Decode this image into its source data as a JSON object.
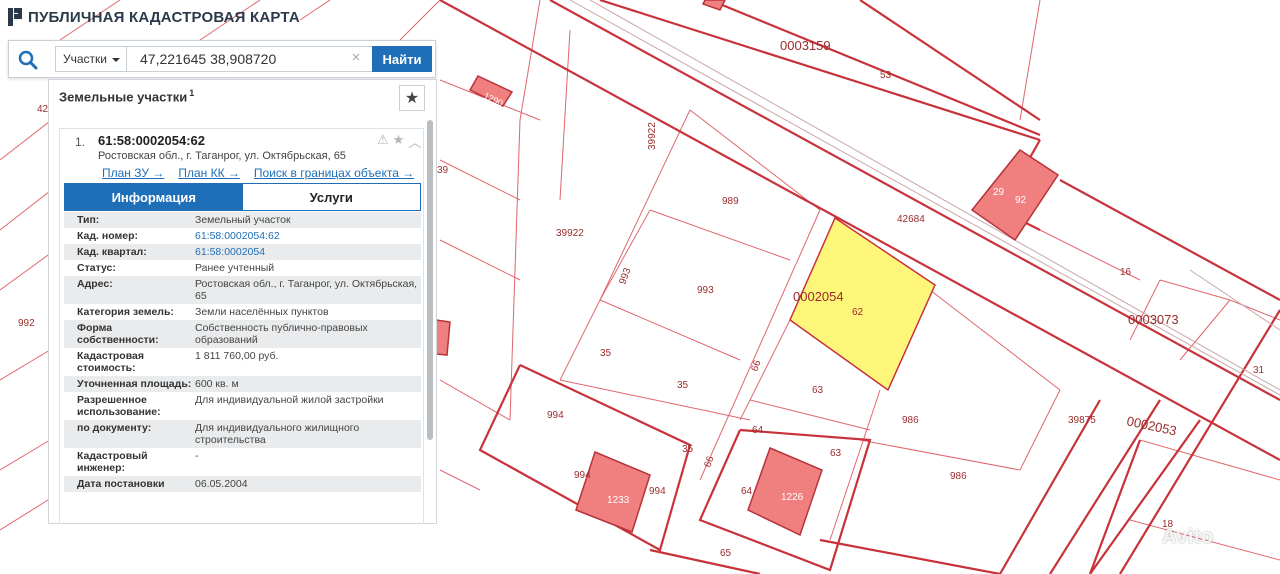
{
  "app": {
    "title": "ПУБЛИЧНАЯ КАДАСТРОВАЯ КАРТА",
    "logo": "pkk-logo-icon"
  },
  "search": {
    "type_label": "Участки",
    "query": "47,221645 38,908720",
    "clear": "×",
    "button": "Найти"
  },
  "panel": {
    "title": "Земельные участки",
    "count": "1",
    "item": {
      "number": "1.",
      "cad_number": "61:58:0002054:62",
      "address": "Ростовская обл., г. Таганрог, ул. Октябрьская, 65",
      "links": [
        "План ЗУ →",
        "План КК →",
        "Поиск в границах объекта →"
      ]
    },
    "tabs": [
      "Информация",
      "Услуги"
    ],
    "properties": [
      {
        "key": "Тип:",
        "value": "Земельный участок"
      },
      {
        "key": "Кад. номер:",
        "value": "61:58:0002054:62",
        "link": true
      },
      {
        "key": "Кад. квартал:",
        "value": "61:58:0002054",
        "link": true
      },
      {
        "key": "Статус:",
        "value": "Ранее учтенный"
      },
      {
        "key": "Адрес:",
        "value": "Ростовская обл., г. Таганрог, ул. Октябрьская, 65"
      },
      {
        "key": "Категория земель:",
        "value": "Земли населённых пунктов"
      },
      {
        "key": "Форма собственности:",
        "value": "Собственность публично-правовых образований"
      },
      {
        "key": "Кадастровая стоимость:",
        "value": "1 811 760,00 руб."
      },
      {
        "key": "Уточненная площадь:",
        "value": "600 кв. м"
      },
      {
        "key": "Разрешенное использование:",
        "value": "Для индивидуальной жилой застройки"
      },
      {
        "key": "по документу:",
        "value": "Для индивидуального жилищного строительства"
      },
      {
        "key": "Кадастровый инженер:",
        "value": "-"
      },
      {
        "key": "Дата постановки",
        "value": "06.05.2004"
      }
    ]
  },
  "map_labels": [
    {
      "id": "q3159",
      "text": "0003159"
    },
    {
      "id": "p53",
      "text": "53"
    },
    {
      "id": "p39922a",
      "text": "39922"
    },
    {
      "id": "p39922b",
      "text": "39922"
    },
    {
      "id": "p989",
      "text": "989"
    },
    {
      "id": "p42684",
      "text": "42684"
    },
    {
      "id": "p29",
      "text": "29"
    },
    {
      "id": "p92",
      "text": "92"
    },
    {
      "id": "p16",
      "text": "16"
    },
    {
      "id": "q3073",
      "text": "0003073"
    },
    {
      "id": "q2054",
      "text": "0002054"
    },
    {
      "id": "p62",
      "text": "62"
    },
    {
      "id": "p993a",
      "text": "993"
    },
    {
      "id": "p993b",
      "text": "993"
    },
    {
      "id": "p35a",
      "text": "35"
    },
    {
      "id": "p35b",
      "text": "35"
    },
    {
      "id": "p35c",
      "text": "35"
    },
    {
      "id": "p63a",
      "text": "63"
    },
    {
      "id": "p63b",
      "text": "63"
    },
    {
      "id": "p66a",
      "text": "66"
    },
    {
      "id": "p66b",
      "text": "66"
    },
    {
      "id": "p64a",
      "text": "64"
    },
    {
      "id": "p64b",
      "text": "64"
    },
    {
      "id": "p986a",
      "text": "986"
    },
    {
      "id": "p986b",
      "text": "986"
    },
    {
      "id": "p39875",
      "text": "39875"
    },
    {
      "id": "q2053",
      "text": "0002053"
    },
    {
      "id": "p994a",
      "text": "994"
    },
    {
      "id": "p994b",
      "text": "994"
    },
    {
      "id": "p994c",
      "text": "994"
    },
    {
      "id": "p1233",
      "text": "1233"
    },
    {
      "id": "p1226",
      "text": "1226"
    },
    {
      "id": "p65",
      "text": "65"
    },
    {
      "id": "p18",
      "text": "18"
    },
    {
      "id": "p992",
      "text": "992"
    },
    {
      "id": "p31",
      "text": "31"
    },
    {
      "id": "p42",
      "text": "42"
    },
    {
      "id": "p39",
      "text": "39"
    },
    {
      "id": "p1290",
      "text": "1290"
    }
  ],
  "watermark": "Avito",
  "colors": {
    "boundary": "#c8323a",
    "building_fill": "#f08080",
    "selected_fill": "#fdf67a",
    "accent": "#1e6fb8"
  }
}
